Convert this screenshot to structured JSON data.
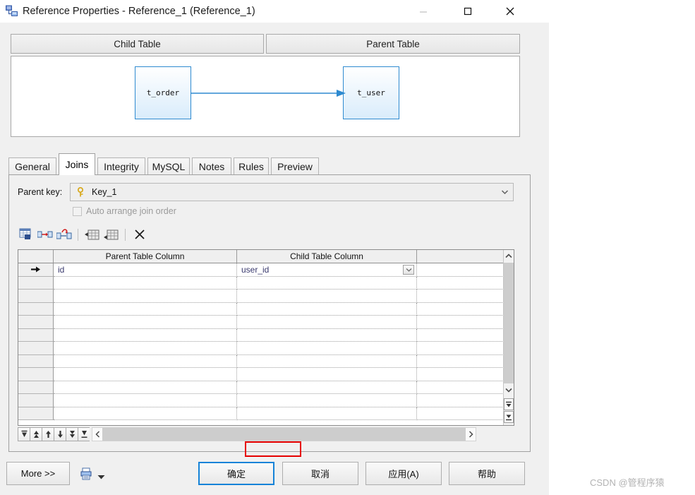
{
  "window": {
    "title": "Reference Properties - Reference_1 (Reference_1)",
    "icon": "reference-diagram-icon",
    "controls": {
      "minimize": "minimize-icon",
      "maximize": "maximize-icon",
      "close": "close-icon"
    }
  },
  "diagram": {
    "child_header": "Child Table",
    "parent_header": "Parent Table",
    "child_node": "t_order",
    "parent_node": "t_user",
    "relation_icon": "arrow-right-icon",
    "node_border_color": "#2e8ad0"
  },
  "tabs": [
    {
      "label": "General",
      "active": false
    },
    {
      "label": "Joins",
      "active": true
    },
    {
      "label": "Integrity",
      "active": false
    },
    {
      "label": "MySQL",
      "active": false
    },
    {
      "label": "Notes",
      "active": false
    },
    {
      "label": "Rules",
      "active": false
    },
    {
      "label": "Preview",
      "active": false
    }
  ],
  "joins": {
    "parent_key_label": "Parent key:",
    "parent_key_value": "Key_1",
    "parent_key_icon": "key-icon",
    "parent_key_dropdown_icon": "chevron-down-icon",
    "auto_arrange_label": "Auto arrange join order",
    "auto_arrange_checked": false,
    "toolbar": [
      {
        "name": "select-columns-icon",
        "label": "Select Columns"
      },
      {
        "name": "add-join-icon",
        "label": "Add Join"
      },
      {
        "name": "edit-join-icon",
        "label": "Edit Join"
      },
      {
        "name": "insert-row-icon",
        "label": "Insert Row"
      },
      {
        "name": "append-row-icon",
        "label": "Append Row"
      },
      {
        "name": "delete-icon",
        "label": "Delete"
      }
    ],
    "grid": {
      "columns": [
        "",
        "Parent Table Column",
        "Child Table Column",
        ""
      ],
      "rows": [
        {
          "marker": "current-row-arrow-icon",
          "parent_column": "id",
          "child_column": "user_id",
          "blank": ""
        },
        {
          "marker": "",
          "parent_column": "",
          "child_column": "",
          "blank": ""
        },
        {
          "marker": "",
          "parent_column": "",
          "child_column": "",
          "blank": ""
        },
        {
          "marker": "",
          "parent_column": "",
          "child_column": "",
          "blank": ""
        },
        {
          "marker": "",
          "parent_column": "",
          "child_column": "",
          "blank": ""
        },
        {
          "marker": "",
          "parent_column": "",
          "child_column": "",
          "blank": ""
        },
        {
          "marker": "",
          "parent_column": "",
          "child_column": "",
          "blank": ""
        },
        {
          "marker": "",
          "parent_column": "",
          "child_column": "",
          "blank": ""
        },
        {
          "marker": "",
          "parent_column": "",
          "child_column": "",
          "blank": ""
        },
        {
          "marker": "",
          "parent_column": "",
          "child_column": "",
          "blank": ""
        },
        {
          "marker": "",
          "parent_column": "",
          "child_column": "",
          "blank": ""
        },
        {
          "marker": "",
          "parent_column": "",
          "child_column": "",
          "blank": ""
        }
      ],
      "highlight_color": "#e60000",
      "highlighted_cell": "user_id"
    },
    "record_nav": [
      "first-record-icon",
      "prev-page-icon",
      "prev-record-icon",
      "next-record-icon",
      "next-page-icon",
      "last-record-icon"
    ]
  },
  "footer": {
    "more": "More >>",
    "print_icon": "print-icon",
    "print_caret": "caret-down-icon",
    "ok": "确定",
    "cancel": "取消",
    "apply": "应用(A)",
    "help": "帮助",
    "accent_color": "#1583d8"
  },
  "watermark": "CSDN @管程序猿"
}
